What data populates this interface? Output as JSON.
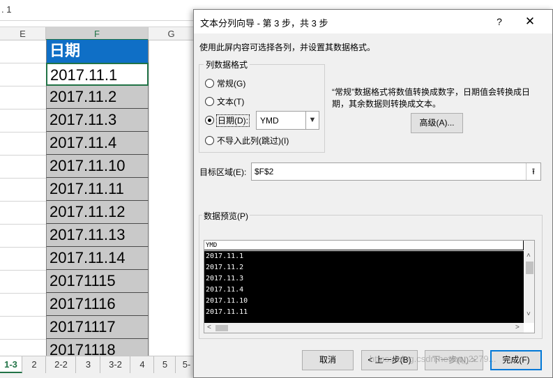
{
  "excel": {
    "formula_text": ". 1",
    "columns": [
      "E",
      "F",
      "G"
    ],
    "header_cell": "日期",
    "cells": [
      "2017.11.1",
      "2017.11.2",
      "2017.11.3",
      "2017.11.4",
      "2017.11.10",
      "2017.11.11",
      "2017.11.12",
      "2017.11.13",
      "2017.11.14",
      "20171115",
      "20171116",
      "20171117",
      "20171118"
    ],
    "sheet_tabs": [
      "1-3",
      "2",
      "2-2",
      "3",
      "3-2",
      "4",
      "5",
      "5-"
    ],
    "active_tab": "1-3",
    "colors": {
      "header_fill": "#0f6fc6",
      "selection": "#217346",
      "cell_fill": "#c9c9c9"
    }
  },
  "dialog": {
    "title": "文本分列向导 - 第 3 步，共 3 步",
    "help_label": "?",
    "close_label": "✕",
    "description": "使用此屏内容可选择各列，并设置其数据格式。",
    "column_format_legend": "列数据格式",
    "radio_options": [
      {
        "label": "常规(G)",
        "checked": false
      },
      {
        "label": "文本(T)",
        "checked": false
      },
      {
        "label": "日期(D):",
        "checked": true
      },
      {
        "label": "不导入此列(跳过)(I)",
        "checked": false
      }
    ],
    "date_format_value": "YMD",
    "info_text": "“常规”数据格式将数值转换成数字，日期值会转换成日期，其余数据则转换成文本。",
    "advanced_button": "高级(A)...",
    "target_label": "目标区域(E):",
    "target_value": "$F$2",
    "preview_label": "数据预览(P)",
    "preview_header": "YMD",
    "preview_rows": [
      "2017.11.1",
      "2017.11.2",
      "2017.11.3",
      "2017.11.4",
      "2017.11.10",
      "2017.11.11"
    ],
    "buttons": {
      "cancel": "取消",
      "back": "< 上一步(B)",
      "next": "下一步(N) >",
      "finish": "完成(F)"
    }
  },
  "watermark": "https://blog.csdn.net/qq_2279..."
}
